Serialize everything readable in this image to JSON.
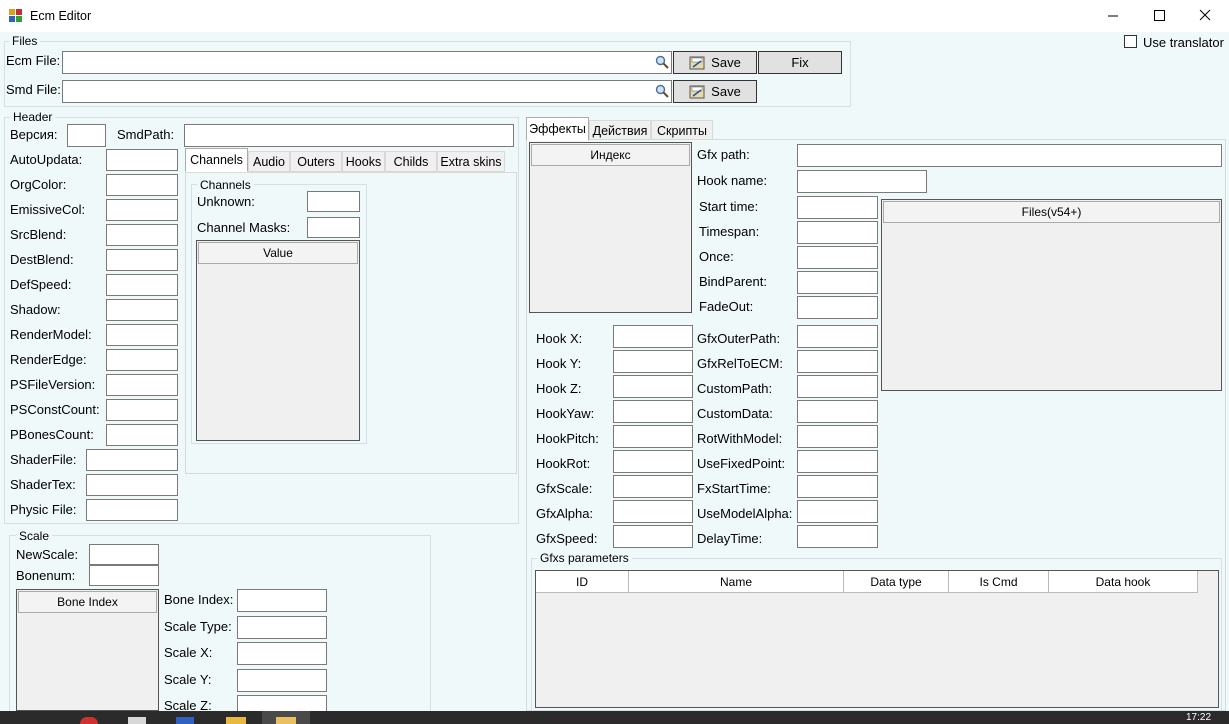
{
  "window": {
    "title": "Ecm Editor"
  },
  "files": {
    "group_title": "Files",
    "ecm_label": "Ecm File:",
    "smd_label": "Smd File:",
    "save_label": "Save",
    "fix_label": "Fix"
  },
  "use_translator": "Use translator",
  "header": {
    "group_title": "Header",
    "version_label": "Версия:",
    "smdpath_label": "SmdPath:",
    "fields": [
      "AutoUpdata:",
      "OrgColor:",
      "EmissiveCol:",
      "SrcBlend:",
      "DestBlend:",
      "DefSpeed:",
      "Shadow:",
      "RenderModel:",
      "RenderEdge:",
      "PSFileVersion:",
      "PSConstCount:",
      "PBonesCount:"
    ],
    "fields2": [
      "ShaderFile:",
      "ShaderTex:",
      "Physic File:"
    ],
    "tabs": [
      "Channels",
      "Audio",
      "Outers",
      "Hooks",
      "Childs",
      "Extra skins"
    ],
    "channels": {
      "group_title": "Channels",
      "unknown_label": "Unknown:",
      "masks_label": "Channel Masks:",
      "value_header": "Value"
    }
  },
  "scale": {
    "group_title": "Scale",
    "newscale_label": "NewScale:",
    "bonenum_label": "Bonenum:",
    "bone_index_header": "Bone Index",
    "fields": [
      "Bone Index:",
      "Scale Type:",
      "Scale X:",
      "Scale Y:",
      "Scale Z:"
    ]
  },
  "right": {
    "tabs": [
      "Эффекты",
      "Действия",
      "Скрипты"
    ],
    "index_header": "Индекс",
    "gfx_path_label": "Gfx path:",
    "hook_name_label": "Hook name:",
    "col_mid": [
      "Start time:",
      "Timespan:",
      "Once:",
      "BindParent:",
      "FadeOut:"
    ],
    "files_header": "Files(v54+)",
    "col_left": [
      "Hook X:",
      "Hook Y:",
      "Hook Z:",
      "HookYaw:",
      "HookPitch:",
      "HookRot:",
      "GfxScale:",
      "GfxAlpha:",
      "GfxSpeed:"
    ],
    "col_right": [
      "GfxOuterPath:",
      "GfxRelToECM:",
      "CustomPath:",
      "CustomData:",
      "RotWithModel:",
      "UseFixedPoint:",
      "FxStartTime:",
      "UseModelAlpha:",
      "DelayTime:"
    ],
    "gfxs_group_title": "Gfxs parameters",
    "grid_headers": [
      "ID",
      "Name",
      "Data type",
      "Is Cmd",
      "Data hook"
    ]
  },
  "taskbar": {
    "clock": "17:22"
  },
  "colors": {
    "accent": "#0078d7",
    "background": "#f0f9f9"
  }
}
